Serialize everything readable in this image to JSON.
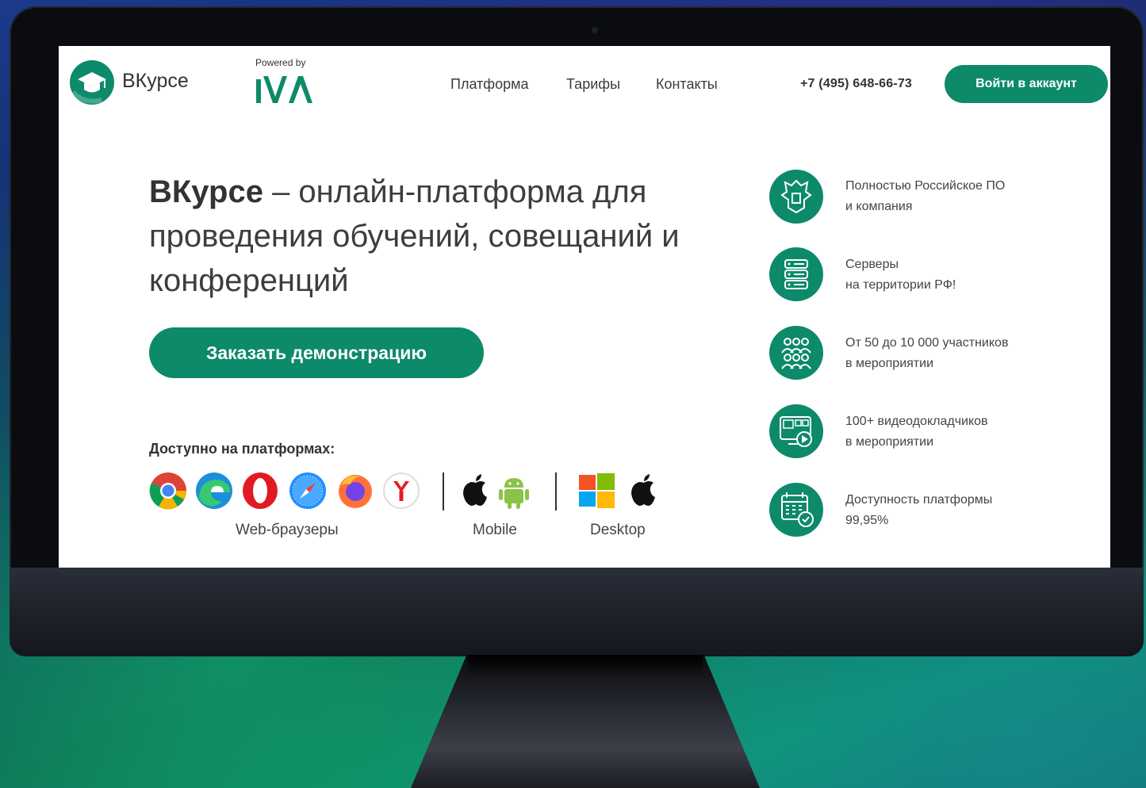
{
  "site": {
    "brand": "ВКурсе",
    "powered_by": "Powered by",
    "partner": "IVA"
  },
  "nav": {
    "items": [
      {
        "label": "Платформа"
      },
      {
        "label": "Тарифы"
      },
      {
        "label": "Контакты"
      }
    ],
    "phone": "+7 (495) 648-66-73",
    "login_label": "Войти в аккаунт"
  },
  "hero": {
    "title_bold": "ВКурсе",
    "title_rest": " – онлайн-платформа для проведения обучений, совещаний и конференций",
    "cta_label": "Заказать демонстрацию"
  },
  "platforms": {
    "title": "Доступно на платформах:",
    "groups": [
      {
        "label": "Web-браузеры",
        "icons": [
          "chrome-icon",
          "edge-icon",
          "opera-icon",
          "safari-icon",
          "firefox-icon",
          "yandex-browser-icon"
        ]
      },
      {
        "label": "Mobile",
        "icons": [
          "apple-icon",
          "android-icon"
        ]
      },
      {
        "label": "Desktop",
        "icons": [
          "windows-icon",
          "apple-icon"
        ]
      }
    ]
  },
  "features": [
    {
      "icon": "coat-of-arms-icon",
      "line1": "Полностью Российское ПО",
      "line2": "и компания"
    },
    {
      "icon": "server-icon",
      "line1": "Серверы",
      "line2": "на территории РФ!"
    },
    {
      "icon": "participants-icon",
      "line1": "От 50 до 10 000 участников",
      "line2": "в мероприятии"
    },
    {
      "icon": "video-speakers-icon",
      "line1": "100+ видеодокладчиков",
      "line2": "в мероприятии"
    },
    {
      "icon": "calendar-check-icon",
      "line1": "Доступность платформы",
      "line2": "99,95%"
    }
  ],
  "colors": {
    "accent": "#0d8a6a",
    "text": "#3d3d3d",
    "screen_bg": "#ffffff"
  }
}
